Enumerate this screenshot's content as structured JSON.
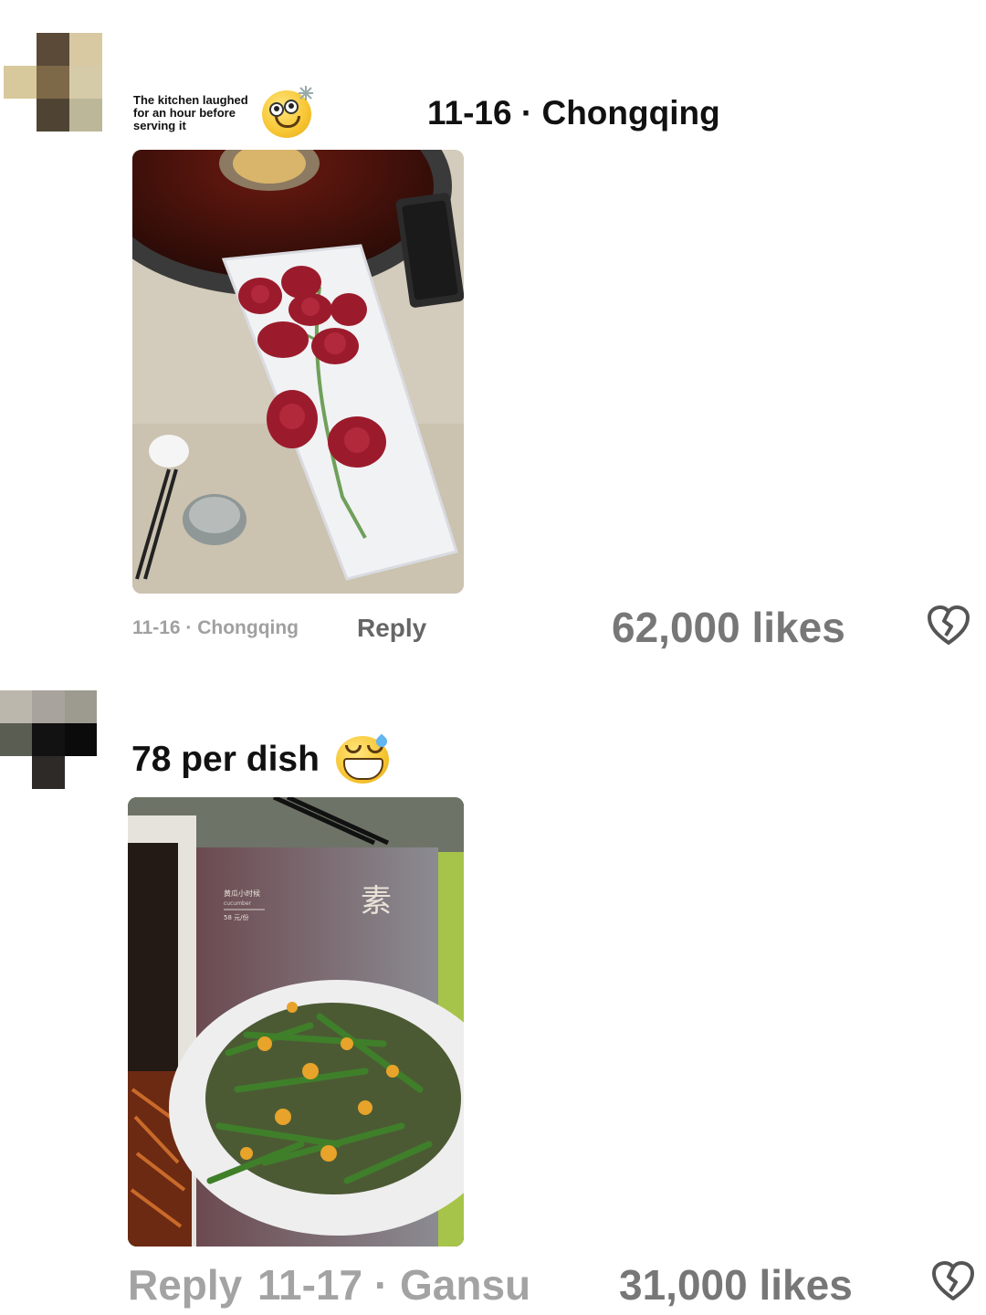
{
  "comments": [
    {
      "caption": "The kitchen laughed for an hour before serving it",
      "header": "11-16 · Chongqing",
      "meta": "11-16 · Chongqing",
      "reply_label": "Reply",
      "likes": "62,000 likes",
      "emoji_icon": "dizzy-smile-emoji",
      "photo_alt": "Plate of sliced meat arranged as a rose beside a hotpot"
    },
    {
      "text": "78 per dish",
      "reply_label": "Reply",
      "meta": "11-17 · Gansu",
      "likes": "31,000 likes",
      "emoji_icon": "grin-sweat-emoji",
      "photo_alt": "Menu page showing stir-fried green beans",
      "menu_char": "素",
      "menu_item_text": "黄瓜小时候",
      "menu_item_sub": "cucumber",
      "menu_item_price": "58 元/份"
    }
  ],
  "colors": {
    "meta_gray": "#a0a0a0",
    "likes_gray": "#777777",
    "reply_gray": "#666666"
  }
}
